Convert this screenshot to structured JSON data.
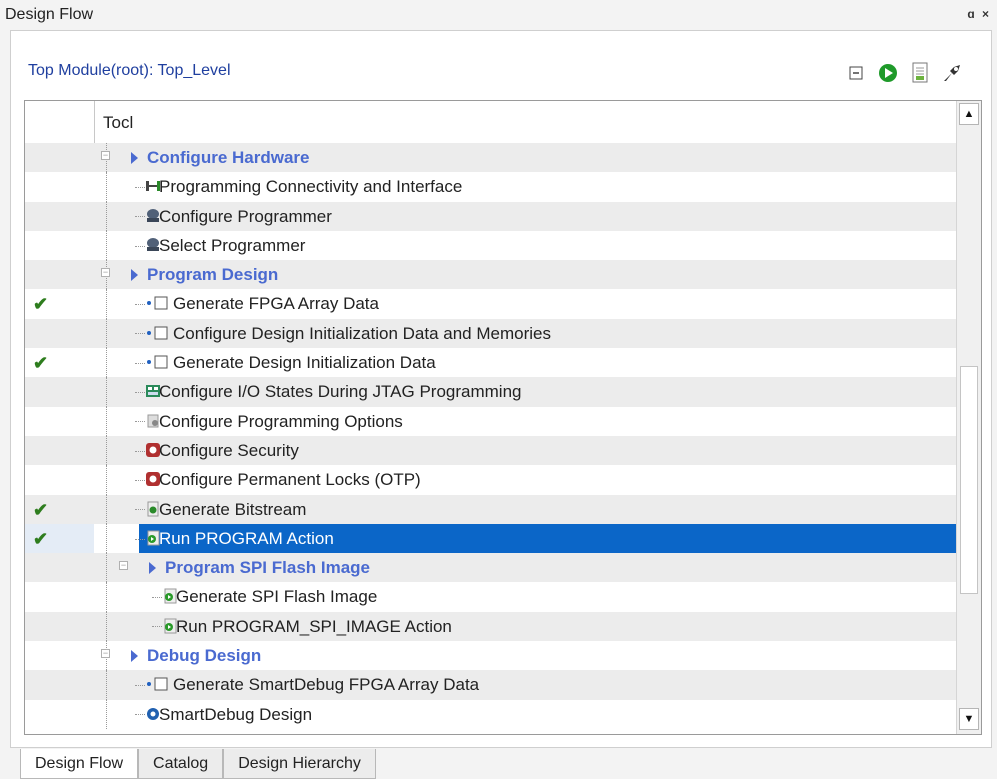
{
  "window": {
    "title": "Design Flow",
    "controls": "ɑ ×"
  },
  "top_module": {
    "label": "Top Module(root): Top_Level"
  },
  "toolbar": {
    "icons": [
      "collapse-icon",
      "run-icon",
      "report-icon",
      "options-icon"
    ]
  },
  "tree": {
    "column_header": "Tocl",
    "rows": [
      {
        "label": "Configure Hardware",
        "type": "group",
        "level": 1,
        "check": false
      },
      {
        "label": "Programming Connectivity and Interface",
        "type": "item",
        "level": 2,
        "icon": "connectivity-icon",
        "check": false
      },
      {
        "label": "Configure Programmer",
        "type": "item",
        "level": 2,
        "icon": "programmer-icon",
        "check": false
      },
      {
        "label": "Select Programmer",
        "type": "item",
        "level": 2,
        "icon": "programmer-icon",
        "check": false
      },
      {
        "label": "Program Design",
        "type": "group",
        "level": 1,
        "check": false
      },
      {
        "label": "Generate FPGA Array Data",
        "type": "item",
        "level": 2,
        "icon": "bullet-box-icon",
        "check": true
      },
      {
        "label": "Configure Design Initialization Data and Memories",
        "type": "item",
        "level": 2,
        "icon": "bullet-box-icon",
        "check": false
      },
      {
        "label": "Generate Design Initialization Data",
        "type": "item",
        "level": 2,
        "icon": "bullet-box-icon",
        "check": true
      },
      {
        "label": "Configure I/O States During JTAG Programming",
        "type": "item",
        "level": 2,
        "icon": "io-states-icon",
        "check": false
      },
      {
        "label": "Configure Programming Options",
        "type": "item",
        "level": 2,
        "icon": "options-doc-icon",
        "check": false
      },
      {
        "label": "Configure Security",
        "type": "item",
        "level": 2,
        "icon": "security-icon",
        "check": false
      },
      {
        "label": "Configure Permanent Locks (OTP)",
        "type": "item",
        "level": 2,
        "icon": "security-icon",
        "check": false
      },
      {
        "label": "Generate Bitstream",
        "type": "item",
        "level": 2,
        "icon": "bitstream-icon",
        "check": true
      },
      {
        "label": "Run PROGRAM Action",
        "type": "item",
        "level": 2,
        "icon": "run-action-icon",
        "check": true,
        "selected": true
      },
      {
        "label": "Program SPI Flash Image",
        "type": "group",
        "level": 2,
        "check": false
      },
      {
        "label": "Generate SPI Flash Image",
        "type": "item",
        "level": 3,
        "icon": "run-action-icon",
        "check": false
      },
      {
        "label": "Run PROGRAM_SPI_IMAGE Action",
        "type": "item",
        "level": 3,
        "icon": "run-action-icon",
        "check": false
      },
      {
        "label": "Debug Design",
        "type": "group",
        "level": 1,
        "check": false
      },
      {
        "label": "Generate SmartDebug FPGA Array Data",
        "type": "item",
        "level": 2,
        "icon": "bullet-box-icon",
        "check": false
      },
      {
        "label": "SmartDebug Design",
        "type": "item",
        "level": 2,
        "icon": "smartdebug-icon",
        "check": false
      }
    ]
  },
  "scrollbar": {
    "up": "▲",
    "down": "▼"
  },
  "tabs": [
    {
      "label": "Design Flow",
      "active": true
    },
    {
      "label": "Catalog",
      "active": false
    },
    {
      "label": "Design Hierarchy",
      "active": false
    }
  ],
  "colors": {
    "accent": "#4a6ad0",
    "selection": "#0b66c8",
    "check": "#2e7d1e"
  }
}
